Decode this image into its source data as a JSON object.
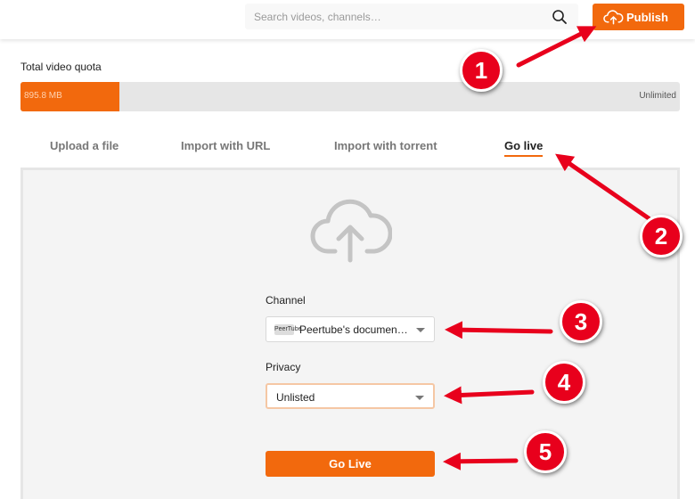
{
  "header": {
    "search_placeholder": "Search videos, channels…",
    "publish_label": "Publish"
  },
  "quota": {
    "label": "Total video quota",
    "used": "895.8 MB",
    "limit": "Unlimited",
    "fill_fraction": 0.15
  },
  "tabs": [
    {
      "label": "Upload a file",
      "active": false
    },
    {
      "label": "Import with URL",
      "active": false
    },
    {
      "label": "Import with torrent",
      "active": false
    },
    {
      "label": "Go live",
      "active": true
    }
  ],
  "form": {
    "channel_label": "Channel",
    "channel_value": "Peertube's documentation",
    "channel_avatar_text": "PeerTube",
    "privacy_label": "Privacy",
    "privacy_value": "Unlisted",
    "submit_label": "Go Live"
  },
  "callouts": [
    "1",
    "2",
    "3",
    "4",
    "5"
  ],
  "colors": {
    "accent": "#f2690d",
    "callout": "#e8001c"
  }
}
